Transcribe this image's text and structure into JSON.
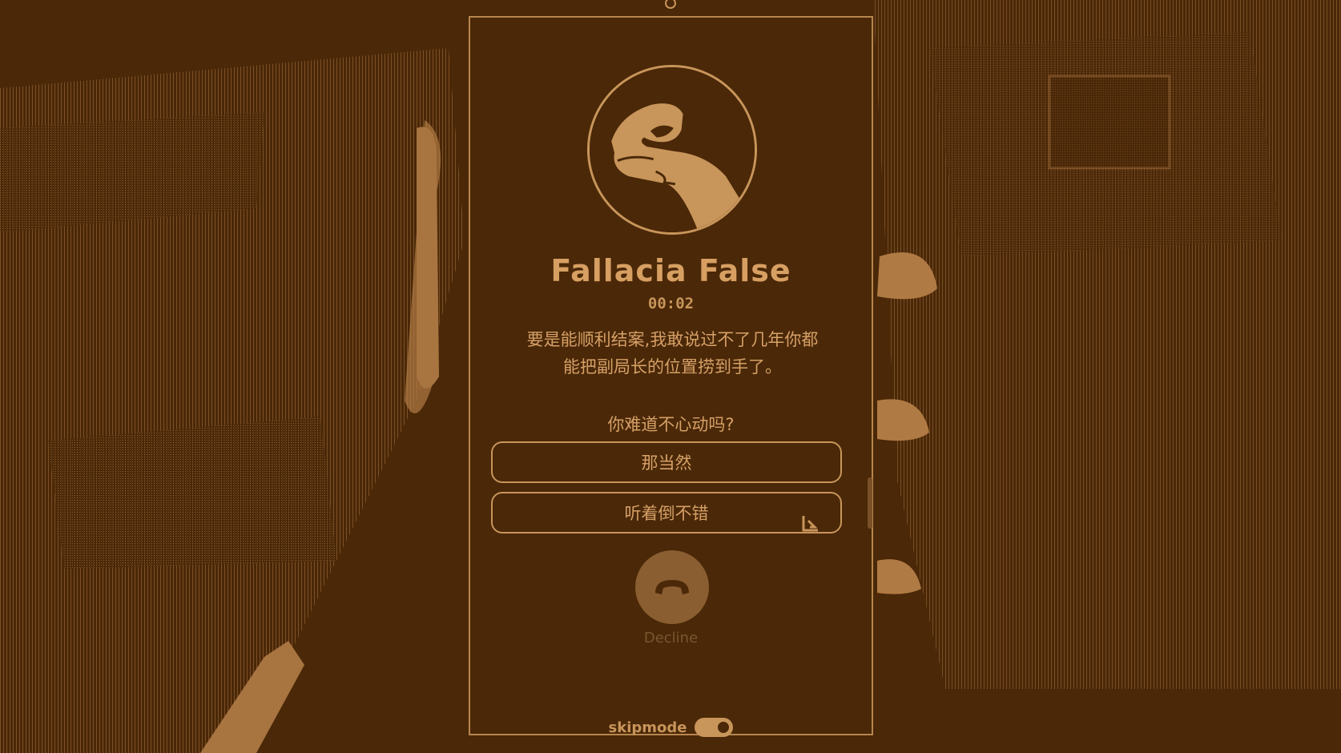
{
  "colors": {
    "background": "#4a2808",
    "accent": "#c8955a",
    "decline_button": "#8a5e31",
    "decline_label": "#7a5530"
  },
  "call": {
    "caller_name": "Fallacia False",
    "timer": "00:02",
    "message_line1": "要是能顺利结案,我敢说过不了几年你都",
    "message_line2": "能把副局长的位置捞到手了。",
    "question": "你难道不心动吗?"
  },
  "choices": [
    {
      "label": "那当然"
    },
    {
      "label": "听着倒不错"
    }
  ],
  "decline": {
    "label": "Decline",
    "icon": "phone-hangup-icon"
  },
  "skipmode": {
    "label": "skipmode",
    "enabled": true
  }
}
